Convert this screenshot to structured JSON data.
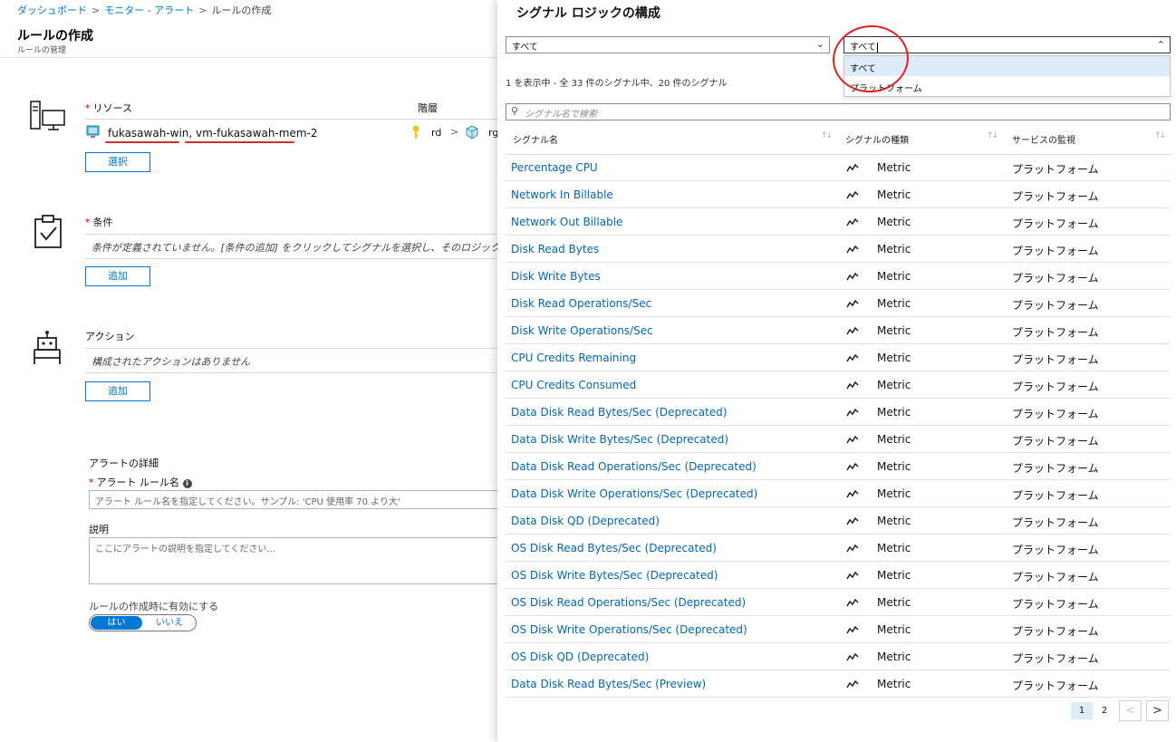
{
  "breadcrumb": {
    "items": [
      "ダッシュボード",
      "モニター - アラート",
      "ルールの作成"
    ],
    "separator": ">"
  },
  "page": {
    "title": "ルールの作成",
    "subtitle": "ルールの管理"
  },
  "resource": {
    "label": "リソース",
    "hierarchy_label": "階層",
    "name": "fukasawah-win, vm-fukasawah-mem-2",
    "hierarchy_rd": "rd",
    "hierarchy_sep": ">",
    "hierarchy_rg": "rg",
    "select_button": "選択"
  },
  "condition": {
    "label": "条件",
    "empty_text": "条件が定義されていません。[条件の追加] をクリックしてシグナルを選択し、そのロジックを定義します",
    "add_button": "追加"
  },
  "action": {
    "label": "アクション",
    "empty_text": "構成されたアクションはありません",
    "add_button": "追加"
  },
  "alert_details": {
    "heading": "アラートの詳細",
    "rule_name_label": "アラート ルール名",
    "rule_name_placeholder": "アラート ルール名を指定してください。サンプル: 'CPU 使用率 70 より大'",
    "description_label": "説明",
    "description_placeholder": "ここにアラートの説明を指定してください...",
    "enable_label": "ルールの作成時に有効にする",
    "toggle_yes": "はい",
    "toggle_no": "いいえ"
  },
  "signal_panel": {
    "title": "シグナル ロジックの構成",
    "filter_type_value": "すべて",
    "filter_service_value": "すべて",
    "dropdown_options": [
      "すべて",
      "プラットフォーム"
    ],
    "count_text": "1 を表示中 - 全 33 件のシグナル中、20 件のシグナル",
    "search_placeholder": "シグナル名で検索",
    "columns": [
      "シグナル名",
      "シグナルの種類",
      "サービスの監視"
    ],
    "rows": [
      {
        "name": "Percentage CPU",
        "type": "Metric",
        "service": "プラットフォーム"
      },
      {
        "name": "Network In Billable",
        "type": "Metric",
        "service": "プラットフォーム"
      },
      {
        "name": "Network Out Billable",
        "type": "Metric",
        "service": "プラットフォーム"
      },
      {
        "name": "Disk Read Bytes",
        "type": "Metric",
        "service": "プラットフォーム"
      },
      {
        "name": "Disk Write Bytes",
        "type": "Metric",
        "service": "プラットフォーム"
      },
      {
        "name": "Disk Read Operations/Sec",
        "type": "Metric",
        "service": "プラットフォーム"
      },
      {
        "name": "Disk Write Operations/Sec",
        "type": "Metric",
        "service": "プラットフォーム"
      },
      {
        "name": "CPU Credits Remaining",
        "type": "Metric",
        "service": "プラットフォーム"
      },
      {
        "name": "CPU Credits Consumed",
        "type": "Metric",
        "service": "プラットフォーム"
      },
      {
        "name": "Data Disk Read Bytes/Sec (Deprecated)",
        "type": "Metric",
        "service": "プラットフォーム"
      },
      {
        "name": "Data Disk Write Bytes/Sec (Deprecated)",
        "type": "Metric",
        "service": "プラットフォーム"
      },
      {
        "name": "Data Disk Read Operations/Sec (Deprecated)",
        "type": "Metric",
        "service": "プラットフォーム"
      },
      {
        "name": "Data Disk Write Operations/Sec (Deprecated)",
        "type": "Metric",
        "service": "プラットフォーム"
      },
      {
        "name": "Data Disk QD (Deprecated)",
        "type": "Metric",
        "service": "プラットフォーム"
      },
      {
        "name": "OS Disk Read Bytes/Sec (Deprecated)",
        "type": "Metric",
        "service": "プラットフォーム"
      },
      {
        "name": "OS Disk Write Bytes/Sec (Deprecated)",
        "type": "Metric",
        "service": "プラットフォーム"
      },
      {
        "name": "OS Disk Read Operations/Sec (Deprecated)",
        "type": "Metric",
        "service": "プラットフォーム"
      },
      {
        "name": "OS Disk Write Operations/Sec (Deprecated)",
        "type": "Metric",
        "service": "プラットフォーム"
      },
      {
        "name": "OS Disk QD (Deprecated)",
        "type": "Metric",
        "service": "プラットフォーム"
      },
      {
        "name": "Data Disk Read Bytes/Sec (Preview)",
        "type": "Metric",
        "service": "プラットフォーム"
      }
    ],
    "pager": {
      "current": "1",
      "next_page": "2",
      "prev": "<",
      "next": ">"
    }
  },
  "colors": {
    "accent": "#0078d4",
    "link": "#0066b8",
    "required": "#cc0000",
    "annotation": "#e02020"
  }
}
